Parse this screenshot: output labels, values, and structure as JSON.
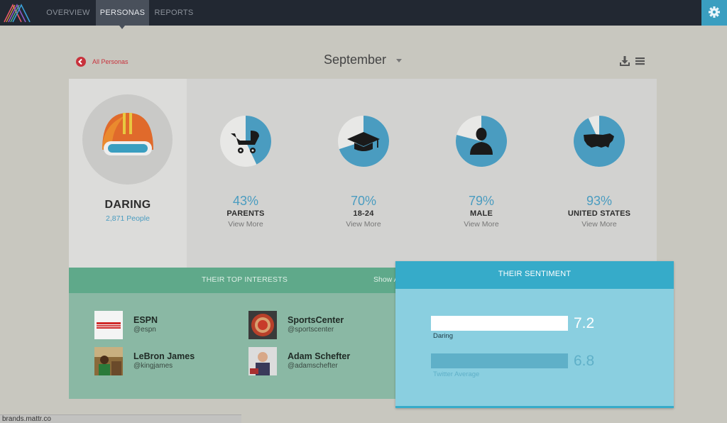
{
  "nav": {
    "tabs": [
      {
        "label": "OVERVIEW"
      },
      {
        "label": "PERSONAS"
      },
      {
        "label": "REPORTS"
      }
    ]
  },
  "header": {
    "back_label": "All Personas",
    "month": "September"
  },
  "persona": {
    "name": "DARING",
    "count": "2,871 People"
  },
  "stats": [
    {
      "pct": "43%",
      "label": "PARENTS",
      "link": "View More",
      "value": 0.43,
      "icon": "stroller-icon"
    },
    {
      "pct": "70%",
      "label": "18-24",
      "link": "View More",
      "value": 0.7,
      "icon": "graduation-cap-icon"
    },
    {
      "pct": "79%",
      "label": "MALE",
      "link": "View More",
      "value": 0.79,
      "icon": "male-person-icon"
    },
    {
      "pct": "93%",
      "label": "UNITED STATES",
      "link": "View More",
      "value": 0.93,
      "icon": "us-map-icon"
    }
  ],
  "interests": {
    "title": "THEIR TOP INTERESTS",
    "show_all": "Show A",
    "items": [
      {
        "name": "ESPN",
        "handle": "@espn"
      },
      {
        "name": "SportsCenter",
        "handle": "@sportscenter"
      },
      {
        "name": "LeBron James",
        "handle": "@kingjames"
      },
      {
        "name": "Adam Schefter",
        "handle": "@adamschefter"
      }
    ]
  },
  "sentiment": {
    "title": "THEIR SENTIMENT",
    "bars": [
      {
        "label": "Daring",
        "value": "7.2"
      },
      {
        "label": "Twitter Average",
        "value": "6.8"
      }
    ]
  },
  "status_bar": "brands.mattr.co",
  "colors": {
    "accent": "#4a9cc0",
    "nav_bg": "#222832",
    "interests_green": "#5fa98a",
    "sentiment_blue": "#36abc9",
    "back_red": "#c8323c"
  }
}
